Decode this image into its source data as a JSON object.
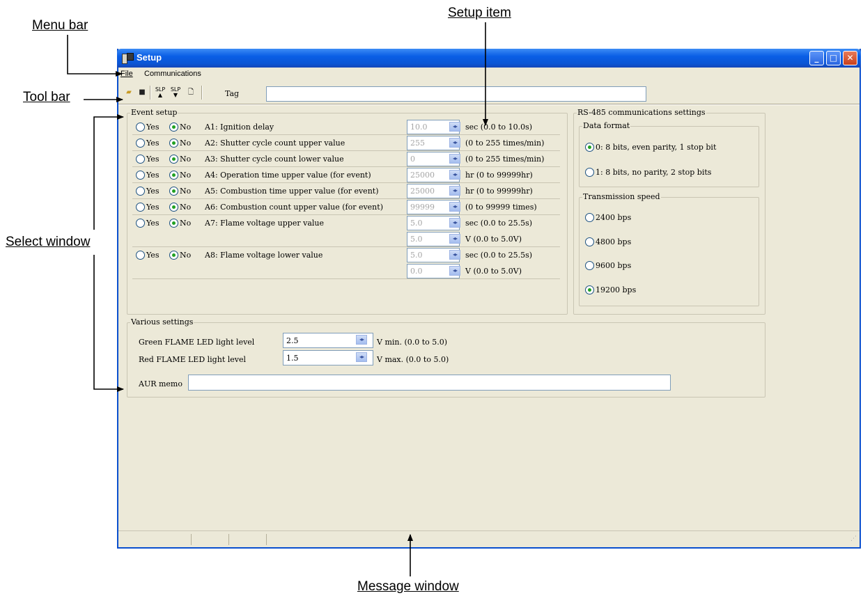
{
  "callouts": {
    "menu_bar": "Menu bar",
    "setup_item": "Setup item",
    "tool_bar": "Tool bar",
    "select_window": "Select window",
    "message_window": "Message window"
  },
  "window": {
    "title": "Setup"
  },
  "menu": {
    "file": "File",
    "communications": "Communications"
  },
  "toolbar": {
    "tag_label": "Tag",
    "tag_value": "",
    "slp_up": "SLP",
    "slp_down": "SLP"
  },
  "yes_label": "Yes",
  "no_label": "No",
  "event_setup": {
    "legend": "Event setup",
    "rows": [
      {
        "label": "A1: Ignition delay",
        "value": "10.0",
        "unit": "sec (0.0 to 10.0s)",
        "selected": "No"
      },
      {
        "label": "A2: Shutter cycle count upper value",
        "value": "255",
        "unit": "(0 to 255 times/min)",
        "selected": "No"
      },
      {
        "label": "A3: Shutter cycle count lower value",
        "value": "0",
        "unit": "(0 to 255 times/min)",
        "selected": "No"
      },
      {
        "label": "A4: Operation time upper value (for event)",
        "value": "25000",
        "unit": "hr (0 to 99999hr)",
        "selected": "No"
      },
      {
        "label": "A5: Combustion time upper value (for event)",
        "value": "25000",
        "unit": "hr (0 to 99999hr)",
        "selected": "No"
      },
      {
        "label": "A6: Combustion count upper value (for event)",
        "value": "99999",
        "unit": "(0 to 99999 times)",
        "selected": "No"
      },
      {
        "label": "A7: Flame voltage upper value",
        "value": "5.0",
        "unit": "sec (0.0 to 25.5s)",
        "value2": "5.0",
        "unit2": "V (0.0 to 5.0V)",
        "selected": "No"
      },
      {
        "label": "A8: Flame voltage lower value",
        "value": "5.0",
        "unit": "sec (0.0 to 25.5s)",
        "value2": "0.0",
        "unit2": "V (0.0 to 5.0V)",
        "selected": "No"
      }
    ]
  },
  "rs485": {
    "legend": "RS-485 communications settings",
    "data_format": {
      "legend": "Data format",
      "options": [
        "0: 8 bits, even parity, 1 stop bit",
        "1: 8 bits, no parity, 2 stop bits"
      ],
      "selected": 0
    },
    "speed": {
      "legend": "Transmission speed",
      "options": [
        "2400 bps",
        "4800 bps",
        "9600 bps",
        "19200 bps"
      ],
      "selected": 3
    }
  },
  "various": {
    "legend": "Various settings",
    "green_label": "Green FLAME LED light level",
    "green_value": "2.5",
    "green_unit": "V min. (0.0 to 5.0)",
    "red_label": "Red FLAME LED light level",
    "red_value": "1.5",
    "red_unit": "V max. (0.0 to 5.0)",
    "memo_label": "AUR memo",
    "memo_value": ""
  },
  "colors": {
    "titlebar": "#0a5ee6",
    "window_bg": "#ece9d8",
    "radio_dot": "#21a121"
  }
}
